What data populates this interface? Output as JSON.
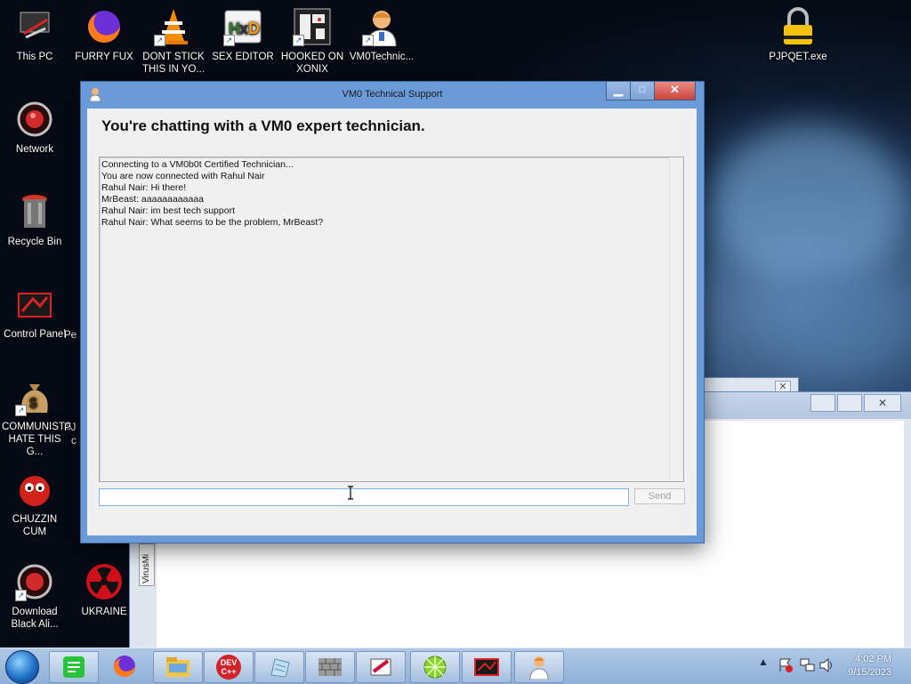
{
  "desktop": {
    "icons": [
      {
        "label": "This PC",
        "icon": "this-pc-icon"
      },
      {
        "label": "FURRY FUX",
        "icon": "firefox-icon"
      },
      {
        "label": "DONT STICK THIS IN YO...",
        "icon": "vlc-cone-icon"
      },
      {
        "label": "SEX EDITOR",
        "icon": "hex-editor-icon"
      },
      {
        "label": "HOOKED ON XONIX",
        "icon": "xonix-game-icon"
      },
      {
        "label": "VM0Technic...",
        "icon": "technician-icon"
      },
      {
        "label": "PJPQET.exe",
        "icon": "padlock-icon"
      },
      {
        "label": "Network",
        "icon": "network-icon"
      },
      {
        "label": "Recycle Bin",
        "icon": "recycle-bin-icon"
      },
      {
        "label": "Control Panel",
        "icon": "control-panel-icon"
      },
      {
        "label": "COMMUNISTS HATE THIS G...",
        "icon": "money-bag-icon"
      },
      {
        "label": "CHUZZIN CUM",
        "icon": "chuzzle-icon"
      },
      {
        "label": "Download Black Ali...",
        "icon": "download-icon"
      },
      {
        "label": "UKRAINE",
        "icon": "radiation-icon"
      }
    ],
    "partial_labels": [
      "Pe",
      "PJ",
      "c"
    ],
    "background_tab_label": "VirusMi"
  },
  "window": {
    "title": "VM0 Technical Support",
    "heading": "You're chatting with a VM0 expert technician.",
    "chat_lines": [
      "Connecting to a VM0b0t Certified Technician...",
      "You are now connected with Rahul Nair",
      "Rahul Nair: Hi there!",
      "MrBeast: aaaaaaaaaaaa",
      "Rahul Nair: im best tech support",
      "Rahul Nair: What seems to be the problem, MrBeast?"
    ],
    "message_input": {
      "value": "",
      "placeholder": ""
    },
    "send_label": "Send",
    "minimize_glyph": "▁",
    "maximize_glyph": "□",
    "close_glyph": "✕"
  },
  "taskbar": {
    "items": [
      "notes-icon",
      "firefox-icon",
      "file-explorer-icon",
      "dev-cpp-icon",
      "notepad-icon",
      "firewall-icon",
      "paint-icon",
      "lime-icon",
      "game-icon",
      "technician-icon"
    ],
    "devcpp_label": "DEV C++",
    "time": "4:02 PM",
    "date": "9/15/2023"
  },
  "colors": {
    "window_frame": "#6b9ad8",
    "close_button": "#c9453b",
    "taskbar": "#9bbade"
  }
}
